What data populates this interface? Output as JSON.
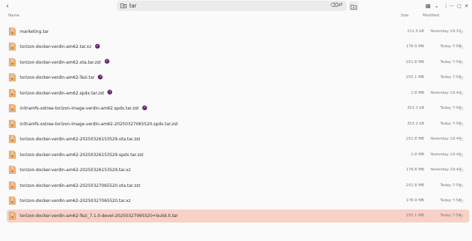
{
  "toolbar": {
    "back_glyph": "‹",
    "search_query": "tar",
    "clear_glyph": "⌫",
    "swap_glyph": "⇄",
    "view_glyph": "▦",
    "dropdown_glyph": "⌄",
    "menu_glyph": "⋮",
    "minimize_glyph": "—",
    "maximize_glyph": "▢",
    "close_glyph": "✕"
  },
  "columns": {
    "name": "Name",
    "size": "Size",
    "modified": "Modified"
  },
  "files": [
    {
      "name": "marketing.tar",
      "link": false,
      "size": "212.5 kB",
      "modified": "Yesterday 19:31",
      "selected": false
    },
    {
      "name": "torizon-docker-verdin-am62.tar.xz",
      "link": true,
      "size": "178.9 MB",
      "modified": "Today 7:58",
      "selected": false
    },
    {
      "name": "torizon-docker-verdin-am62.ota.tar.zst",
      "link": true,
      "size": "251.8 MB",
      "modified": "Today 7:59",
      "selected": false
    },
    {
      "name": "torizon-docker-verdin-am62-Tezi.tar",
      "link": true,
      "size": "255.1 MB",
      "modified": "Today 7:59",
      "selected": false
    },
    {
      "name": "torizon-docker-verdin-am62.spdx.tar.zst",
      "link": true,
      "size": "2.8 MB",
      "modified": "Yesterday 19:42",
      "selected": false
    },
    {
      "name": "initramfs-ostree-torizon-image-verdin-am62.spdx.tar.zst",
      "link": true,
      "size": "353.2 kB",
      "modified": "Today 7:56",
      "selected": false
    },
    {
      "name": "initramfs-ostree-torizon-image-verdin-am62-20250327065520.spdx.tar.zst",
      "link": false,
      "size": "353.2 kB",
      "modified": "Today 7:56",
      "selected": false
    },
    {
      "name": "torizon-docker-verdin-am62-20250326153529.ota.tar.zst",
      "link": false,
      "size": "251.8 MB",
      "modified": "Yesterday 19:44",
      "selected": false
    },
    {
      "name": "torizon-docker-verdin-am62-20250326153529.spdx.tar.zst",
      "link": false,
      "size": "2.8 MB",
      "modified": "Yesterday 19:42",
      "selected": false
    },
    {
      "name": "torizon-docker-verdin-am62-20250326153529.tar.xz",
      "link": false,
      "size": "178.8 MB",
      "modified": "Yesterday 19:43",
      "selected": false
    },
    {
      "name": "torizon-docker-verdin-am62-20250327065520.ota.tar.zst",
      "link": false,
      "size": "251.8 MB",
      "modified": "Today 7:59",
      "selected": false
    },
    {
      "name": "torizon-docker-verdin-am62-20250327065520.tar.xz",
      "link": false,
      "size": "178.9 MB",
      "modified": "Today 7:58",
      "selected": false
    },
    {
      "name": "torizon-docker-verdin-am62-Tezi_7.1.0-devel-20250327065520+build.0.tar",
      "link": false,
      "size": "255.1 MB",
      "modified": "Today 7:59",
      "selected": true
    }
  ],
  "link_glyph": "↗",
  "star_glyph": "☆",
  "colors": {
    "selected_row": "#f7d1c6",
    "archive_icon": "#e8a060",
    "link_badge": "#6c2272"
  }
}
